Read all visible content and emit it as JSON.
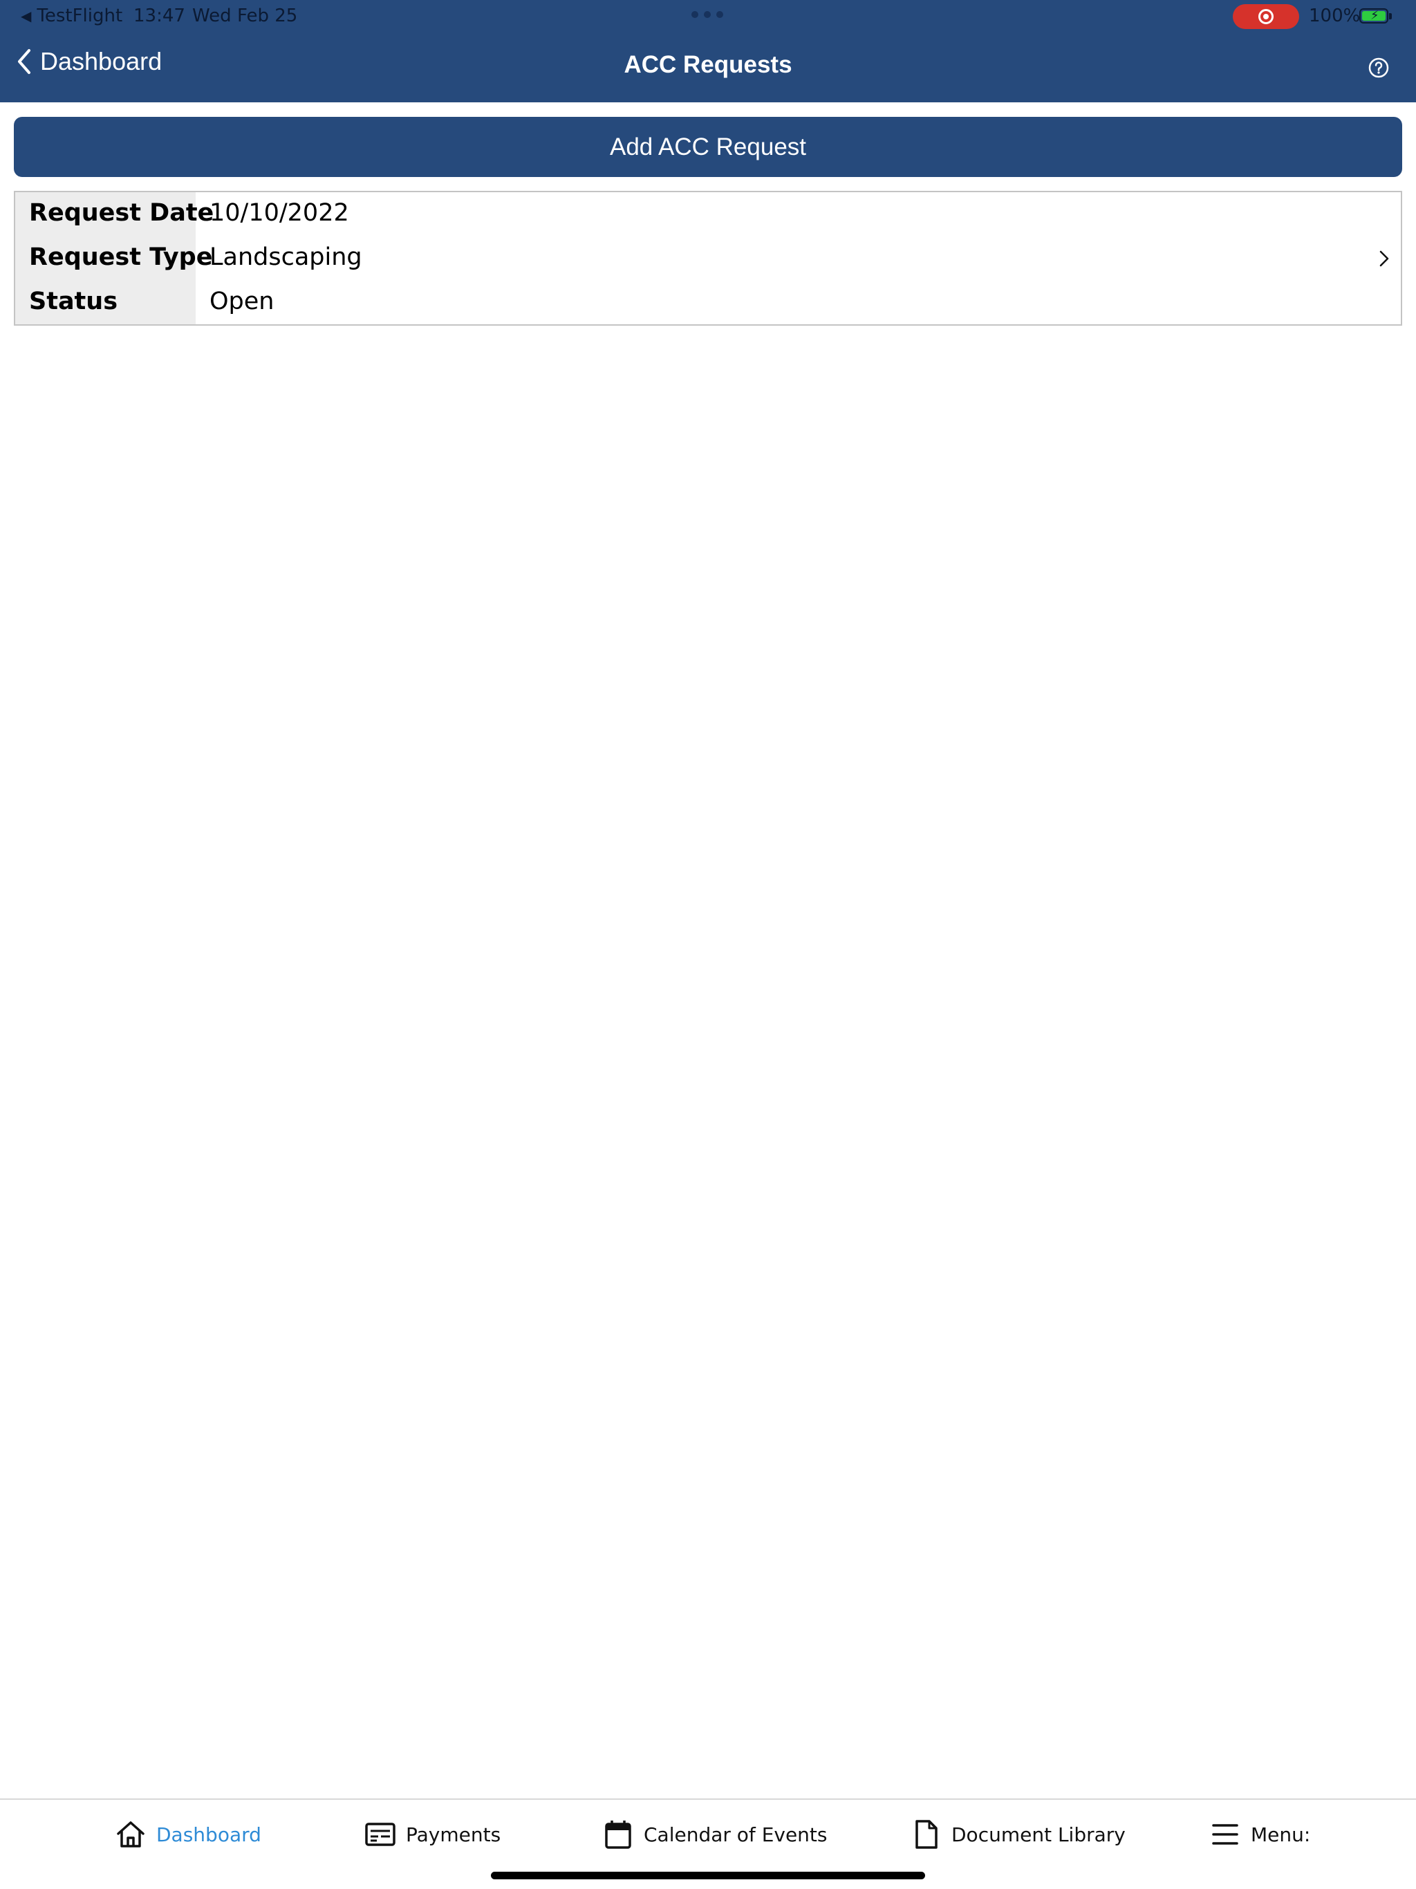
{
  "status_bar": {
    "back_app": "TestFlight",
    "time": "13:47",
    "date": "Wed Feb 25",
    "battery": "100%"
  },
  "nav": {
    "back_label": "Dashboard",
    "title": "ACC Requests"
  },
  "add_button_label": "Add ACC Request",
  "request": {
    "date_label": "Request Date",
    "date_value": "10/10/2022",
    "type_label": "Request Type",
    "type_value": "Landscaping",
    "status_label": "Status",
    "status_value": "Open"
  },
  "tabs": [
    {
      "label": "Dashboard",
      "icon": "home-icon"
    },
    {
      "label": "Payments",
      "icon": "payment-card-icon"
    },
    {
      "label": "Calendar of Events",
      "icon": "calendar-icon"
    },
    {
      "label": "Document Library",
      "icon": "document-icon"
    },
    {
      "label": "Menu:",
      "icon": "hamburger-menu-icon"
    }
  ],
  "colors": {
    "brand": "#264a7c",
    "active_tab": "#2e8bd6",
    "record": "#d6322b"
  }
}
